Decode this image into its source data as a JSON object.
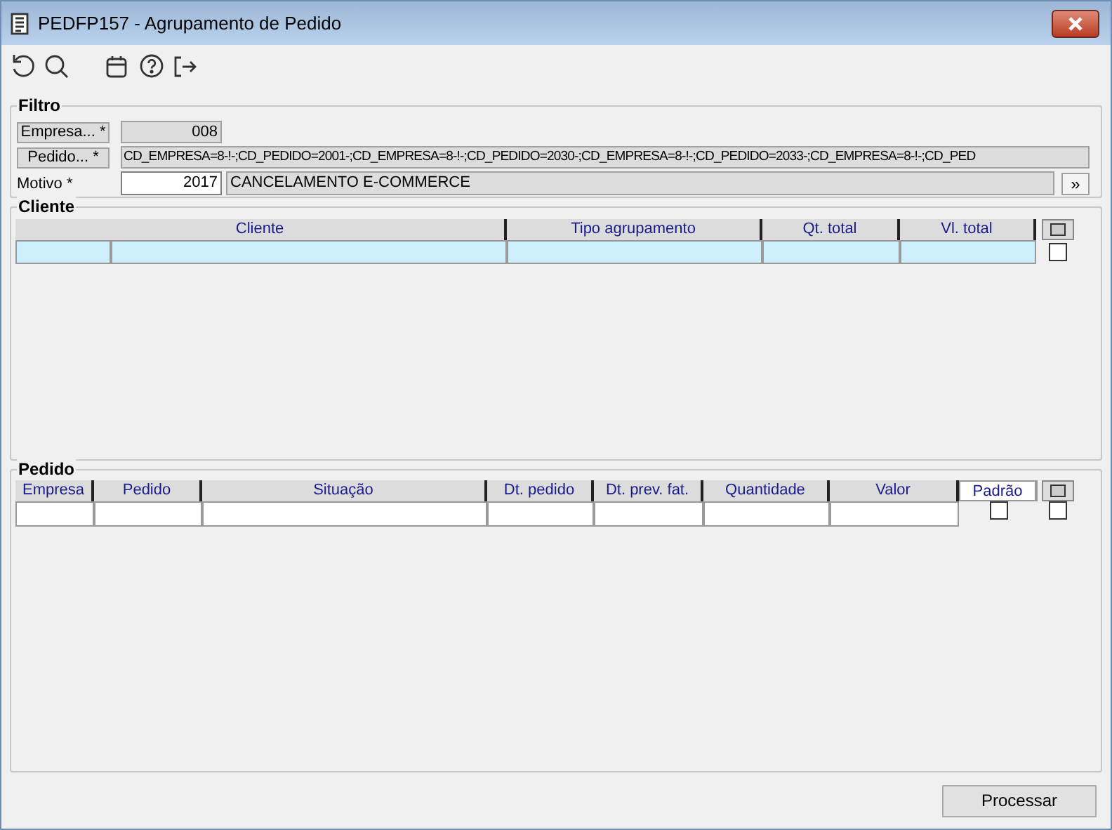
{
  "window": {
    "title": "PEDFP157 - Agrupamento de Pedido"
  },
  "filtro": {
    "title": "Filtro",
    "empresa": {
      "label": "Empresa... *",
      "value": "008"
    },
    "pedido": {
      "label": "Pedido... *",
      "value": "CD_EMPRESA=8-!-;CD_PEDIDO=2001-;CD_EMPRESA=8-!-;CD_PEDIDO=2030-;CD_EMPRESA=8-!-;CD_PEDIDO=2033-;CD_EMPRESA=8-!-;CD_PED"
    },
    "motivo": {
      "label": "Motivo *",
      "code": "2017",
      "description": "CANCELAMENTO E-COMMERCE",
      "button": "»"
    }
  },
  "cliente": {
    "title": "Cliente",
    "columns": [
      "Cliente",
      "Tipo agrupamento",
      "Qt. total",
      "Vl. total"
    ],
    "rows": [
      {
        "selected": true,
        "checked": false
      }
    ]
  },
  "pedido": {
    "title": "Pedido",
    "columns": [
      "Empresa",
      "Pedido",
      "Situação",
      "Dt. pedido",
      "Dt. prev. fat.",
      "Quantidade",
      "Valor",
      "Padrão"
    ],
    "rows": [
      {
        "selected": false,
        "padrao": false,
        "checked": false
      }
    ]
  },
  "buttons": [
    "Processar"
  ]
}
